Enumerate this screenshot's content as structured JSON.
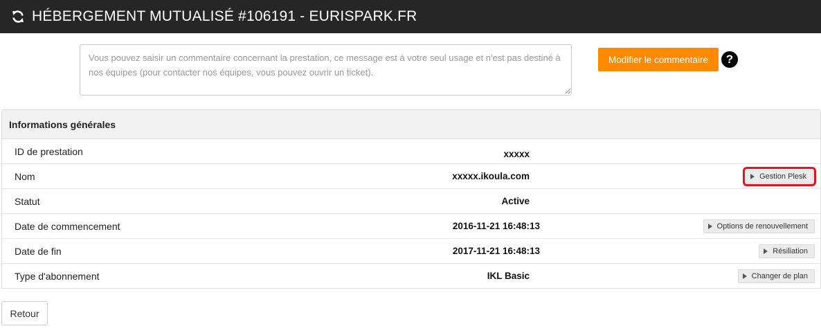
{
  "header": {
    "title": "HÉBERGEMENT MUTUALISÉ #106191 - EURISPARK.FR",
    "icon": "refresh-icon"
  },
  "comment": {
    "placeholder": "Vous pouvez saisir un commentaire concernant la prestation, ce message est à votre seul usage et n'est pas destiné à nos équipes (pour contacter nos équipes, vous pouvez ouvrir un ticket).",
    "value": "",
    "button_label": "Modifier le commentaire",
    "help_icon": "question-circle-icon"
  },
  "panel": {
    "title": "Informations générales",
    "rows": [
      {
        "label": "ID de prestation",
        "value": "xxxxx",
        "action": ""
      },
      {
        "label": "Nom",
        "value": "xxxxx.ikoula.com",
        "action": "Gestion Plesk"
      },
      {
        "label": "Statut",
        "value": "Active",
        "action": ""
      },
      {
        "label": "Date de commencement",
        "value": "2016-11-21 16:48:13",
        "action": "Options de renouvellement"
      },
      {
        "label": "Date de fin",
        "value": "2017-11-21 16:48:13",
        "action": "Résiliation"
      },
      {
        "label": "Type d'abonnement",
        "value": "IKL Basic",
        "action": "Changer de plan"
      }
    ]
  },
  "footer": {
    "back_label": "Retour"
  },
  "colors": {
    "header_bg": "#262626",
    "accent_orange": "#ff8a00",
    "highlight_red": "#e0141e"
  }
}
